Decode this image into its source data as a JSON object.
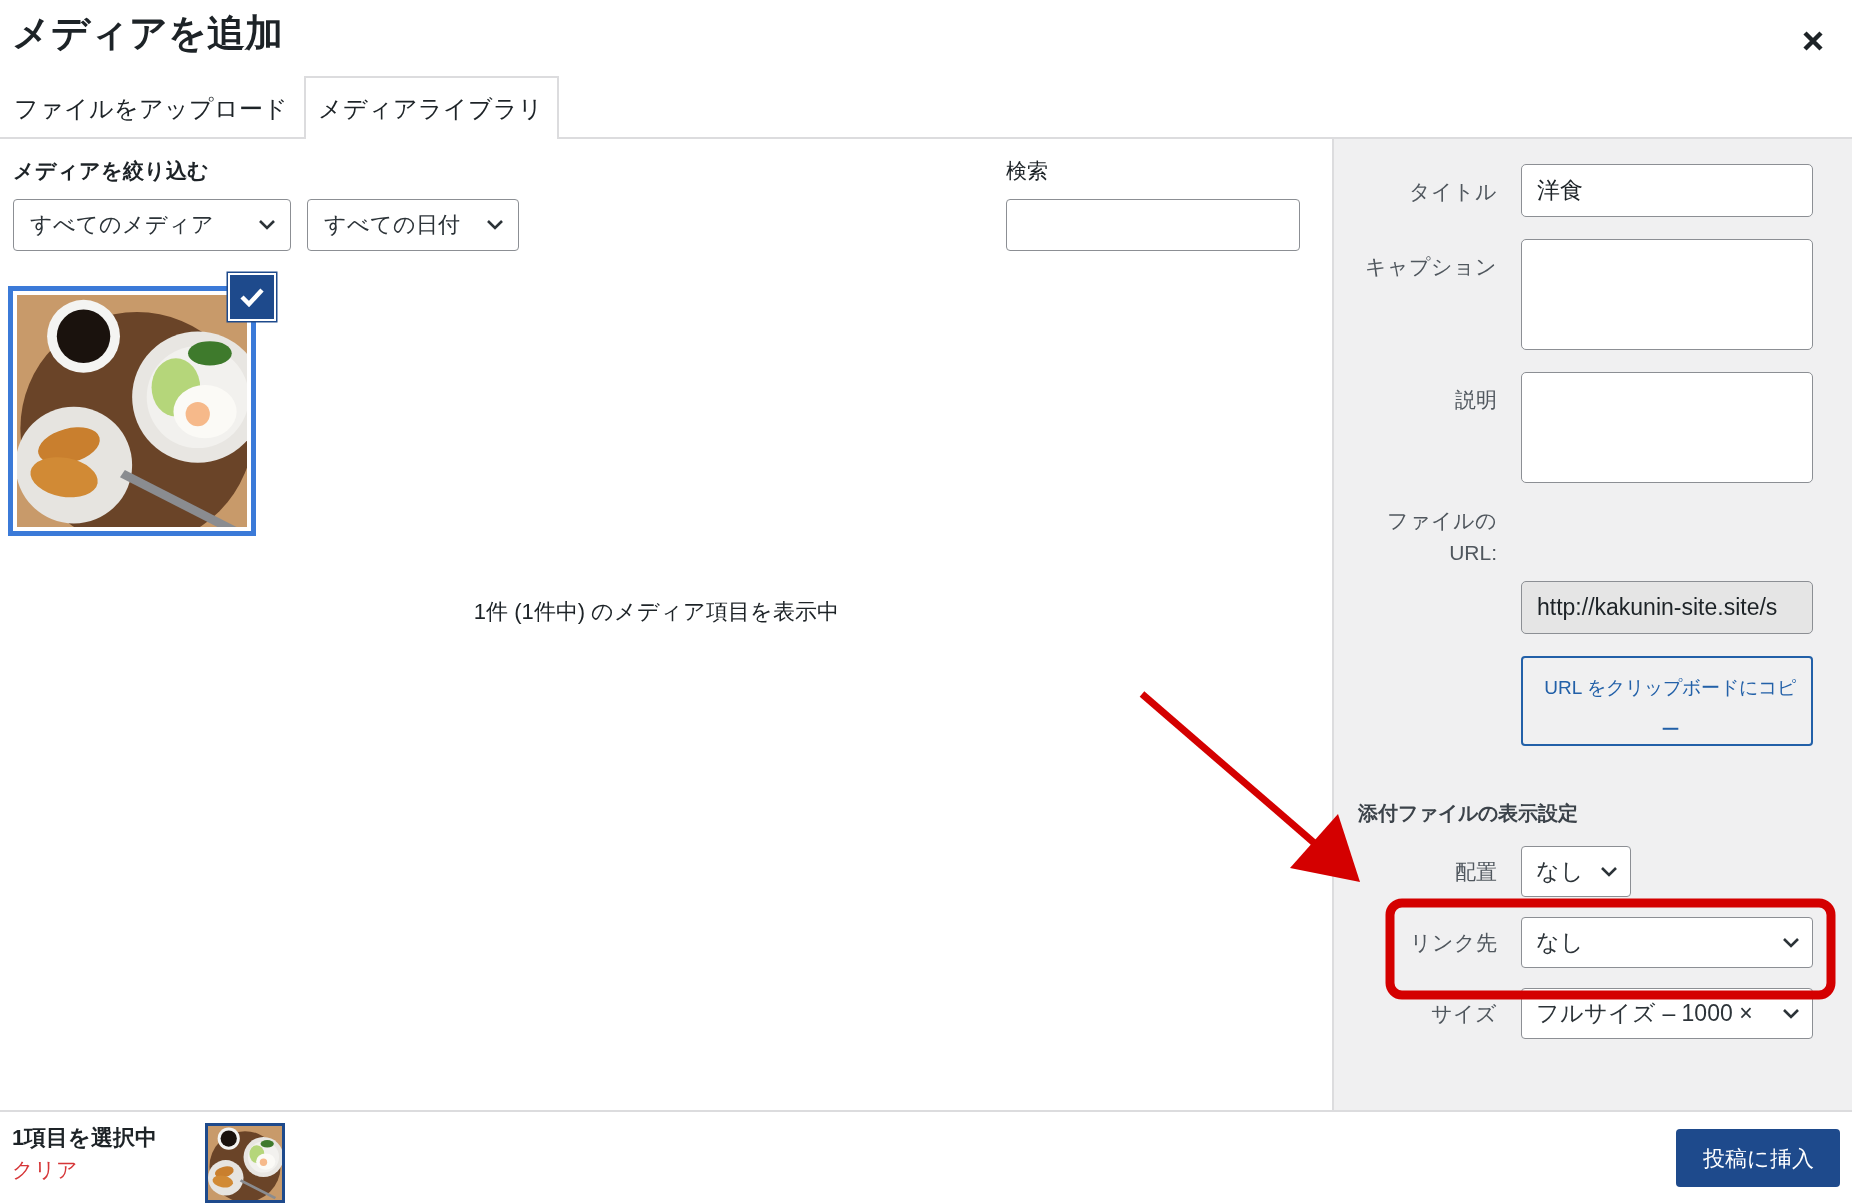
{
  "dialog": {
    "title": "メディアを追加"
  },
  "tabs": [
    {
      "label": "ファイルをアップロード",
      "selected": false
    },
    {
      "label": "メディアライブラリ",
      "selected": true
    }
  ],
  "filter": {
    "label": "メディアを絞り込む",
    "selects": [
      {
        "value": "すべてのメディア"
      },
      {
        "value": "すべての日付"
      }
    ],
    "search_label": "検索"
  },
  "media_items": [
    {
      "kind": "picture",
      "selected": true
    }
  ],
  "count_text": "1件 (1件中) のメディア項目を表示中",
  "details": {
    "fields": [
      {
        "label": "タイトル",
        "kind": "input",
        "value": "洋食"
      },
      {
        "label": "キャプション",
        "kind": "textarea"
      },
      {
        "label": "説明",
        "kind": "textarea"
      },
      {
        "label": "ファイルの URL:",
        "kind": "readonly",
        "value": "http://kakunin-site.site/s"
      }
    ],
    "copy_button": "URL をクリップボードにコピー"
  },
  "display_settings": {
    "heading": "添付ファイルの表示設定",
    "rows": [
      {
        "label": "配置",
        "value": "なし",
        "kind": "narrow"
      },
      {
        "label": "リンク先",
        "value": "なし",
        "kind": "wide"
      },
      {
        "label": "サイズ",
        "value": "フルサイズ – 1000 ×",
        "kind": "wide"
      }
    ]
  },
  "footer": {
    "selection_text": "1項目を選択中",
    "clear_link": "クリア",
    "insert_button": "投稿に挿入"
  }
}
